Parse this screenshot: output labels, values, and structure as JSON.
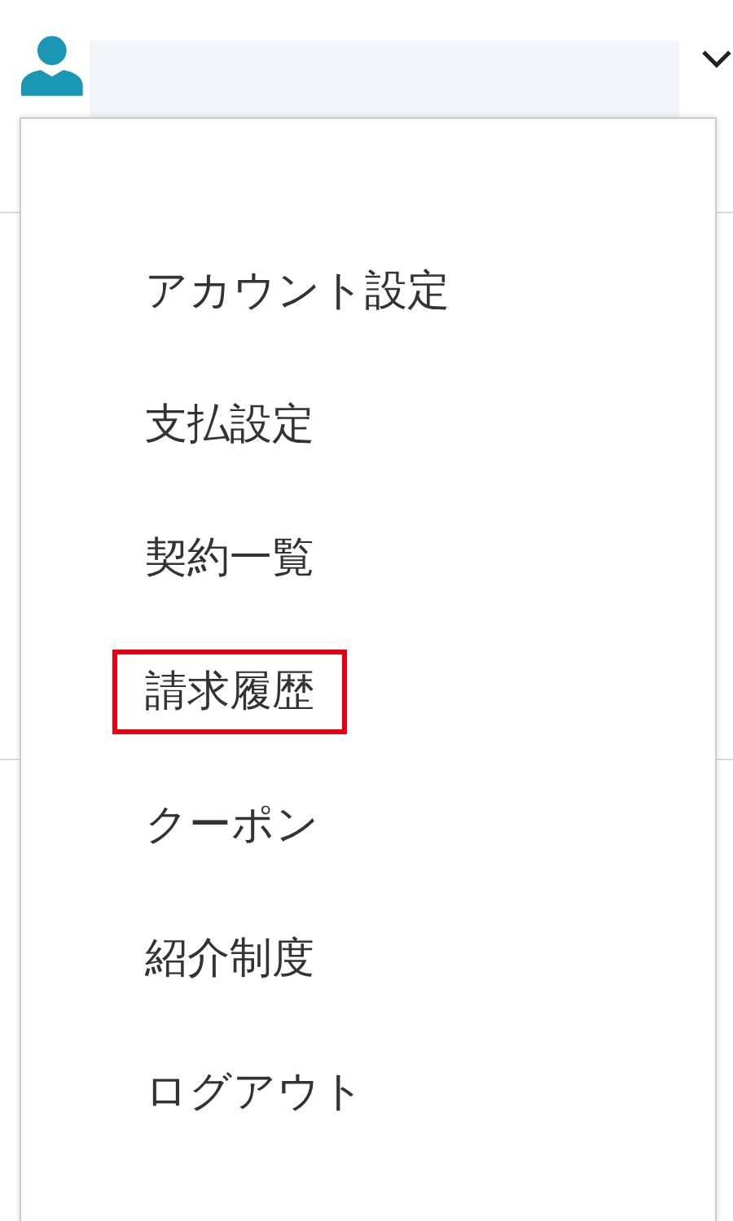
{
  "account_menu": {
    "expanded": true,
    "items": [
      {
        "label": "アカウント設定",
        "highlighted": false
      },
      {
        "label": "支払設定",
        "highlighted": false
      },
      {
        "label": "契約一覧",
        "highlighted": false
      },
      {
        "label": "請求履歴",
        "highlighted": true
      },
      {
        "label": "クーポン",
        "highlighted": false
      },
      {
        "label": "紹介制度",
        "highlighted": false
      },
      {
        "label": "ログアウト",
        "highlighted": false
      }
    ]
  }
}
